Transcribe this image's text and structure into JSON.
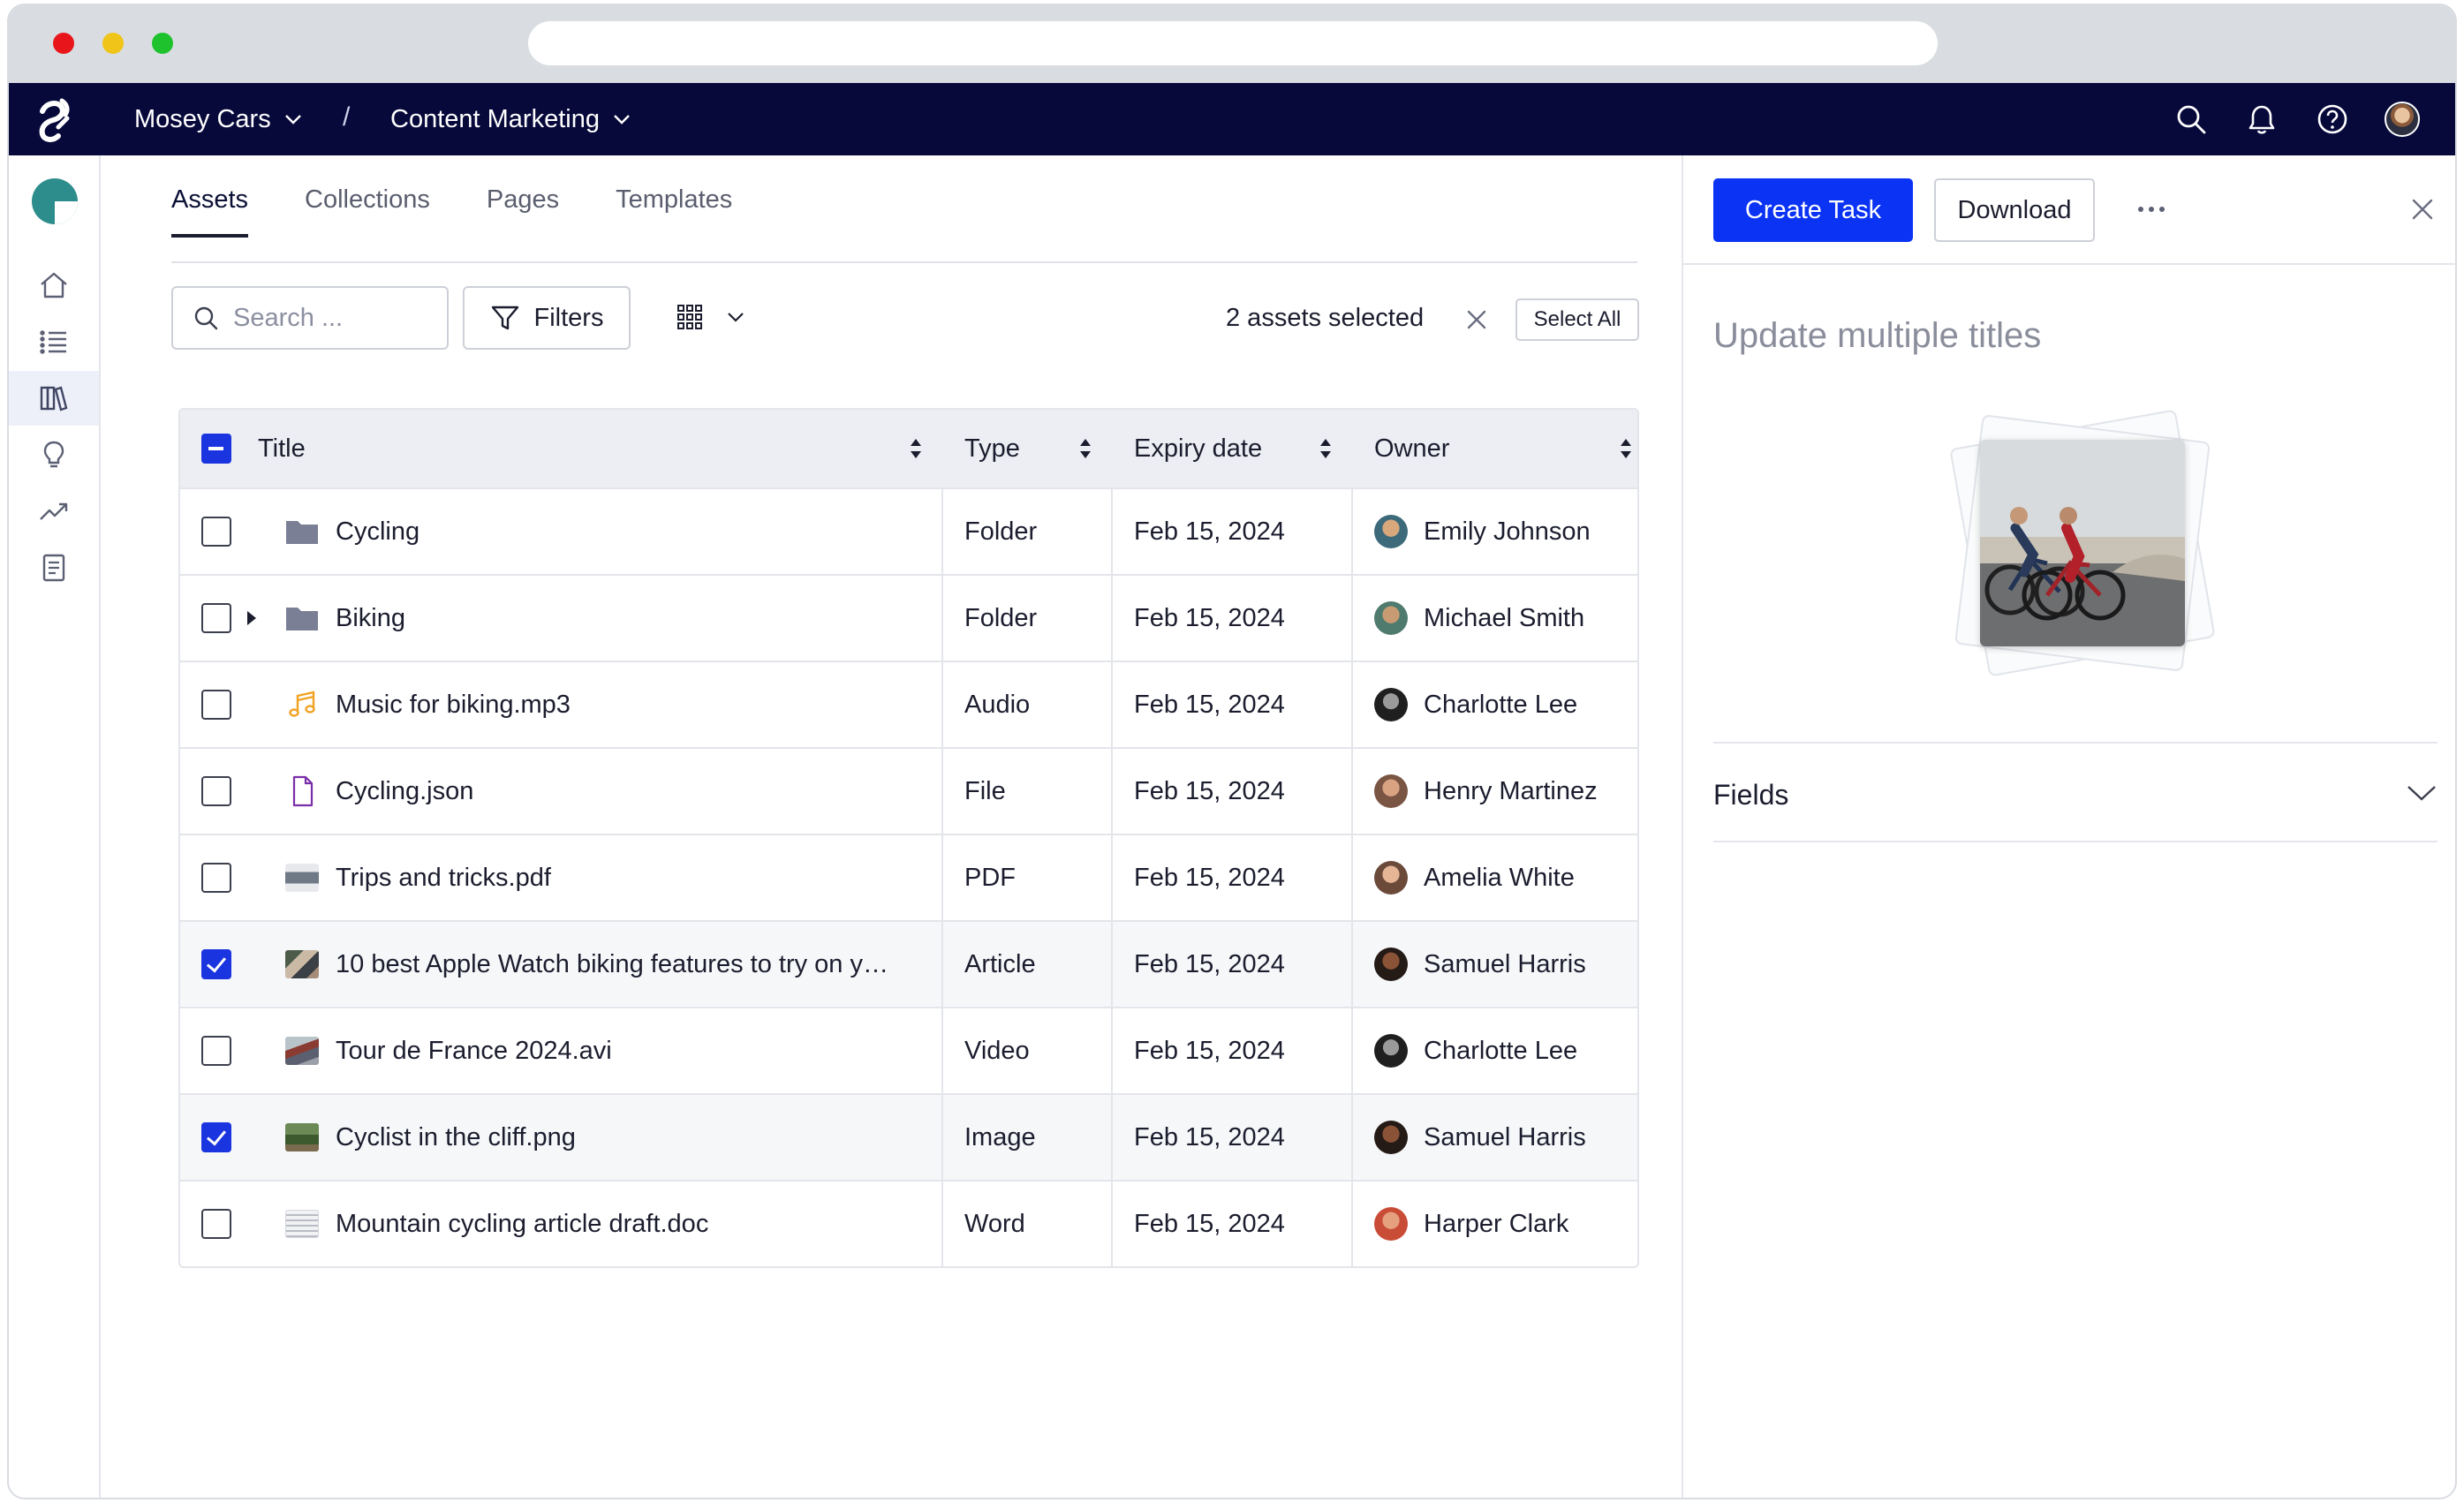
{
  "topnav": {
    "workspace": "Mosey Cars",
    "separator": "/",
    "project": "Content Marketing"
  },
  "tabs": [
    {
      "label": "Assets",
      "active": true
    },
    {
      "label": "Collections",
      "active": false
    },
    {
      "label": "Pages",
      "active": false
    },
    {
      "label": "Templates",
      "active": false
    }
  ],
  "toolbar": {
    "search_placeholder": "Search ...",
    "filters_label": "Filters",
    "selection_count": "2 assets selected",
    "select_all_label": "Select All"
  },
  "table": {
    "headers": {
      "title": "Title",
      "type": "Type",
      "expiry": "Expiry date",
      "owner": "Owner"
    },
    "rows": [
      {
        "title": "Cycling",
        "type": "Folder",
        "expiry": "Feb 15, 2024",
        "owner": "Emily Johnson",
        "checked": false,
        "icon": "folder-icon"
      },
      {
        "title": "Biking",
        "type": "Folder",
        "expiry": "Feb 15, 2024",
        "owner": "Michael Smith",
        "checked": false,
        "icon": "folder-icon",
        "expandable": true
      },
      {
        "title": "Music for biking.mp3",
        "type": "Audio",
        "expiry": "Feb 15, 2024",
        "owner": "Charlotte Lee",
        "checked": false,
        "icon": "music-note-icon"
      },
      {
        "title": "Cycling.json",
        "type": "File",
        "expiry": "Feb 15, 2024",
        "owner": "Henry Martinez",
        "checked": false,
        "icon": "file-icon"
      },
      {
        "title": "Trips and tricks.pdf",
        "type": "PDF",
        "expiry": "Feb 15, 2024",
        "owner": "Amelia White",
        "checked": false,
        "icon": "pdf-thumbnail"
      },
      {
        "title": "10 best Apple Watch biking features to try on y…",
        "type": "Article",
        "expiry": "Feb 15, 2024",
        "owner": "Samuel Harris",
        "checked": true,
        "icon": "article-thumbnail"
      },
      {
        "title": "Tour de France 2024.avi",
        "type": "Video",
        "expiry": "Feb 15, 2024",
        "owner": "Charlotte Lee",
        "checked": false,
        "icon": "video-thumbnail"
      },
      {
        "title": "Cyclist in the cliff.png",
        "type": "Image",
        "expiry": "Feb 15, 2024",
        "owner": "Samuel Harris",
        "checked": true,
        "icon": "image-thumbnail"
      },
      {
        "title": "Mountain cycling article draft.doc",
        "type": "Word",
        "expiry": "Feb 15, 2024",
        "owner": "Harper Clark",
        "checked": false,
        "icon": "doc-thumbnail"
      }
    ]
  },
  "panel": {
    "create_task_label": "Create Task",
    "download_label": "Download",
    "title": "Update multiple titles",
    "fields_label": "Fields"
  },
  "colors": {
    "nav_bg": "#07093b",
    "primary": "#0b33f4",
    "checkbox": "#1a35e0"
  }
}
